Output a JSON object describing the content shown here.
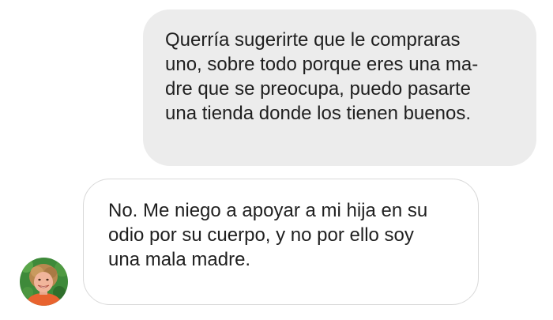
{
  "conversation": {
    "messages": [
      {
        "sender": "me",
        "lines": [
          "Querría sugerirte que le compraras",
          "uno, sobre todo porque eres una ma-",
          "dre que se preocupa, puedo pasarte",
          "una tienda donde los tienen buenos."
        ]
      },
      {
        "sender": "contact",
        "lines": [
          "No. Me niego a apoyar a mi hija en su",
          "odio por su cuerpo, y no por ello soy",
          "una mala madre."
        ]
      }
    ]
  },
  "colors": {
    "outgoing_bubble": "#ececec",
    "incoming_bubble": "#ffffff",
    "incoming_border": "#d9d9d9",
    "text": "#1f1f1f",
    "avatar_background": "#3e8a3a"
  },
  "icons": {
    "avatar": "contact-avatar-photo"
  }
}
